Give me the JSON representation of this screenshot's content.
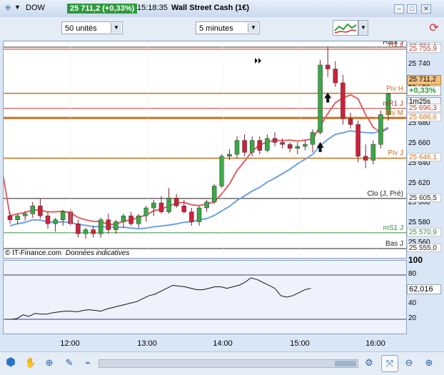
{
  "header": {
    "symbol": "DOW",
    "price_change": "25 711,2 (+0,33%)",
    "time": "15:18:35",
    "instrument": "Wall Street Cash (1€)"
  },
  "toolbar": {
    "units_select": "50 unités",
    "period_select": "5 minutes"
  },
  "chart": {
    "watermark": "© IT-Finance.com",
    "disclaimer": "Données indicatives",
    "price_ticks": [
      "25 740",
      "25 720",
      "25 680",
      "25 660",
      "25 640",
      "25 620",
      "25 600",
      "25 580",
      "25 560"
    ],
    "time_ticks": [
      "12:00",
      "13:00",
      "14:00",
      "15:00",
      "16:00"
    ],
    "levels": [
      {
        "name": "Haut J",
        "value": "25 758,0",
        "color": "#333333"
      },
      {
        "name": "R1 J",
        "value": "25 755,9",
        "color": "#c0392b"
      },
      {
        "name": "Piv H",
        "value": "",
        "color": "#c8701f"
      },
      {
        "name": "mR1 J",
        "value": "25 696,3",
        "color": "#c0392b"
      },
      {
        "name": "Piv M",
        "value": "25 686,6",
        "color": "#c8701f"
      },
      {
        "name": "Piv J",
        "value": "25 646,1",
        "color": "#c8701f"
      },
      {
        "name": "Clo (J, Pré)",
        "value": "25 605,5",
        "color": "#222222"
      },
      {
        "name": "mS1 J",
        "value": "25 570,9",
        "color": "#2e8b3c"
      },
      {
        "name": "Bas J",
        "value": "25 555,0",
        "color": "#222222"
      }
    ],
    "current_price": "25 711,2",
    "current_change": "+0,33%",
    "countdown": "1m25s",
    "colors": {
      "up": "#3aa845",
      "down": "#d0203a",
      "ma_slow": "#6fa0e0",
      "ma_fast": "#e06060"
    }
  },
  "chart_data": {
    "type": "candlestick",
    "xlabel": "",
    "ylabel": "",
    "ylim": [
      25550,
      25765
    ],
    "candles": [
      {
        "t": "11:15",
        "o": 25588,
        "h": 25592,
        "l": 25580,
        "c": 25584
      },
      {
        "t": "11:20",
        "o": 25584,
        "h": 25590,
        "l": 25580,
        "c": 25588
      },
      {
        "t": "11:25",
        "o": 25588,
        "h": 25593,
        "l": 25583,
        "c": 25590
      },
      {
        "t": "11:30",
        "o": 25590,
        "h": 25602,
        "l": 25586,
        "c": 25598
      },
      {
        "t": "11:35",
        "o": 25598,
        "h": 25605,
        "l": 25585,
        "c": 25588
      },
      {
        "t": "11:40",
        "o": 25588,
        "h": 25592,
        "l": 25575,
        "c": 25580
      },
      {
        "t": "11:45",
        "o": 25580,
        "h": 25586,
        "l": 25572,
        "c": 25584
      },
      {
        "t": "11:50",
        "o": 25584,
        "h": 25594,
        "l": 25578,
        "c": 25592
      },
      {
        "t": "11:55",
        "o": 25592,
        "h": 25595,
        "l": 25578,
        "c": 25580
      },
      {
        "t": "12:00",
        "o": 25580,
        "h": 25584,
        "l": 25566,
        "c": 25570
      },
      {
        "t": "12:05",
        "o": 25570,
        "h": 25576,
        "l": 25565,
        "c": 25574
      },
      {
        "t": "12:10",
        "o": 25574,
        "h": 25578,
        "l": 25566,
        "c": 25570
      },
      {
        "t": "12:15",
        "o": 25570,
        "h": 25586,
        "l": 25566,
        "c": 25584
      },
      {
        "t": "12:20",
        "o": 25584,
        "h": 25590,
        "l": 25570,
        "c": 25574
      },
      {
        "t": "12:25",
        "o": 25574,
        "h": 25584,
        "l": 25570,
        "c": 25582
      },
      {
        "t": "12:30",
        "o": 25582,
        "h": 25590,
        "l": 25576,
        "c": 25588
      },
      {
        "t": "12:35",
        "o": 25588,
        "h": 25592,
        "l": 25578,
        "c": 25580
      },
      {
        "t": "12:40",
        "o": 25580,
        "h": 25590,
        "l": 25576,
        "c": 25588
      },
      {
        "t": "12:45",
        "o": 25588,
        "h": 25598,
        "l": 25582,
        "c": 25596
      },
      {
        "t": "12:50",
        "o": 25596,
        "h": 25604,
        "l": 25588,
        "c": 25601
      },
      {
        "t": "12:55",
        "o": 25601,
        "h": 25608,
        "l": 25590,
        "c": 25592
      },
      {
        "t": "13:00",
        "o": 25592,
        "h": 25616,
        "l": 25590,
        "c": 25606
      },
      {
        "t": "13:05",
        "o": 25606,
        "h": 25610,
        "l": 25596,
        "c": 25598
      },
      {
        "t": "13:10",
        "o": 25598,
        "h": 25604,
        "l": 25590,
        "c": 25592
      },
      {
        "t": "13:15",
        "o": 25592,
        "h": 25596,
        "l": 25578,
        "c": 25582
      },
      {
        "t": "13:20",
        "o": 25582,
        "h": 25598,
        "l": 25578,
        "c": 25596
      },
      {
        "t": "13:25",
        "o": 25596,
        "h": 25604,
        "l": 25592,
        "c": 25602
      },
      {
        "t": "13:30",
        "o": 25602,
        "h": 25620,
        "l": 25600,
        "c": 25618
      },
      {
        "t": "13:35",
        "o": 25618,
        "h": 25650,
        "l": 25616,
        "c": 25648
      },
      {
        "t": "13:40",
        "o": 25648,
        "h": 25655,
        "l": 25644,
        "c": 25650
      },
      {
        "t": "13:45",
        "o": 25650,
        "h": 25668,
        "l": 25646,
        "c": 25664
      },
      {
        "t": "13:50",
        "o": 25664,
        "h": 25670,
        "l": 25648,
        "c": 25652
      },
      {
        "t": "13:55",
        "o": 25652,
        "h": 25668,
        "l": 25648,
        "c": 25664
      },
      {
        "t": "14:00",
        "o": 25664,
        "h": 25668,
        "l": 25650,
        "c": 25654
      },
      {
        "t": "14:05",
        "o": 25654,
        "h": 25670,
        "l": 25652,
        "c": 25666
      },
      {
        "t": "14:10",
        "o": 25666,
        "h": 25672,
        "l": 25658,
        "c": 25662
      },
      {
        "t": "14:15",
        "o": 25662,
        "h": 25666,
        "l": 25656,
        "c": 25660
      },
      {
        "t": "14:20",
        "o": 25660,
        "h": 25662,
        "l": 25652,
        "c": 25656
      },
      {
        "t": "14:25",
        "o": 25656,
        "h": 25662,
        "l": 25650,
        "c": 25658
      },
      {
        "t": "14:30",
        "o": 25658,
        "h": 25664,
        "l": 25654,
        "c": 25660
      },
      {
        "t": "14:35",
        "o": 25660,
        "h": 25675,
        "l": 25652,
        "c": 25672
      },
      {
        "t": "14:40",
        "o": 25672,
        "h": 25745,
        "l": 25670,
        "c": 25740
      },
      {
        "t": "14:45",
        "o": 25740,
        "h": 25758,
        "l": 25728,
        "c": 25736
      },
      {
        "t": "14:50",
        "o": 25736,
        "h": 25744,
        "l": 25718,
        "c": 25722
      },
      {
        "t": "14:55",
        "o": 25722,
        "h": 25730,
        "l": 25680,
        "c": 25686
      },
      {
        "t": "15:00",
        "o": 25686,
        "h": 25692,
        "l": 25676,
        "c": 25680
      },
      {
        "t": "15:05",
        "o": 25680,
        "h": 25684,
        "l": 25642,
        "c": 25648
      },
      {
        "t": "15:10",
        "o": 25648,
        "h": 25660,
        "l": 25636,
        "c": 25644
      },
      {
        "t": "15:15",
        "o": 25644,
        "h": 25664,
        "l": 25640,
        "c": 25660
      },
      {
        "t": "15:20",
        "o": 25660,
        "h": 25694,
        "l": 25656,
        "c": 25690
      },
      {
        "t": "15:25",
        "o": 25690,
        "h": 25712,
        "l": 25684,
        "c": 25711
      }
    ],
    "oscillator": {
      "value_label": "62,016",
      "ylim": [
        0,
        100
      ],
      "ticks": [
        "100",
        "80",
        "60",
        "40",
        "20"
      ],
      "bands": [
        20,
        80
      ]
    }
  },
  "bottom_toolbar": {
    "icons": [
      "chart-tools-icon",
      "hand-icon",
      "crosshair-icon",
      "pencil-icon",
      "indicator-icon",
      "lines-icon",
      "settings-icon",
      "zoom-fit-icon",
      "zoom-out-icon",
      "zoom-in-icon"
    ]
  }
}
